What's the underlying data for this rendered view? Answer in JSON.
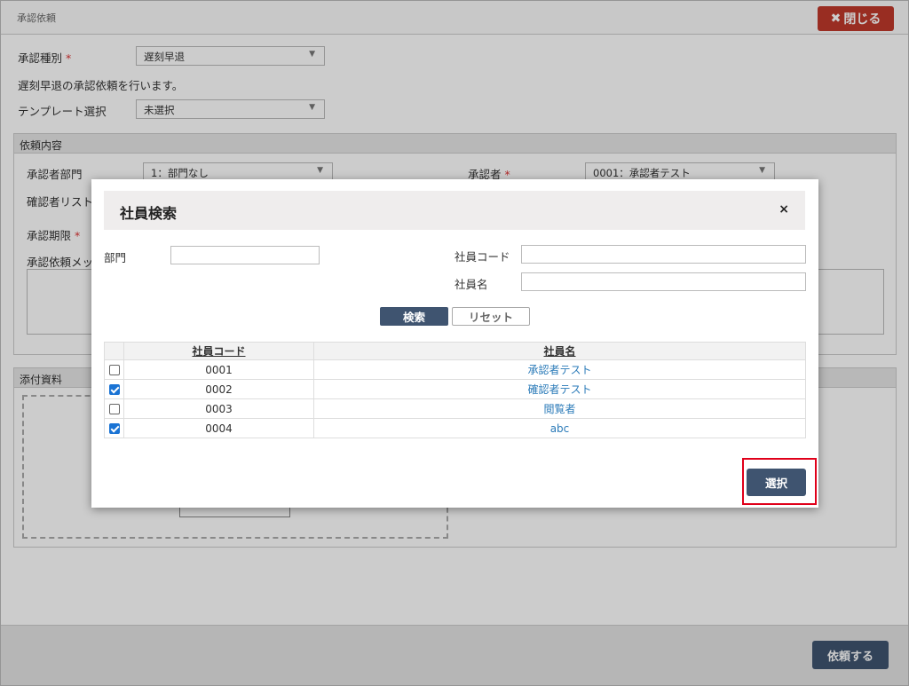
{
  "window": {
    "title": "承認依頼",
    "close_button": "閉じる",
    "close_icon": "✖"
  },
  "form": {
    "approval_type_label": "承認種別",
    "required_mark": "*",
    "approval_type_value": "遅刻早退",
    "description": "遅刻早退の承認依頼を行います。",
    "template_label": "テンプレート選択",
    "template_value": "未選択"
  },
  "request_section": {
    "heading": "依頼内容",
    "approver_dept_label": "承認者部門",
    "approver_dept_value": "1：部門なし",
    "approver_label": "承認者",
    "approver_value": "0001：承認者テスト",
    "confirmer_list_label": "確認者リスト",
    "deadline_label": "承認期限",
    "message_label": "承認依頼メッ"
  },
  "attachment_section": {
    "heading": "添付資料"
  },
  "footer": {
    "request_button": "依頼する"
  },
  "modal": {
    "title": "社員検索",
    "close_icon": "×",
    "dept_label": "部門",
    "code_label": "社員コード",
    "name_label": "社員名",
    "search_button": "検索",
    "reset_button": "リセット",
    "columns": [
      "社員コード",
      "社員名"
    ],
    "rows": [
      {
        "code": "0001",
        "name": "承認者テスト",
        "checked": false
      },
      {
        "code": "0002",
        "name": "確認者テスト",
        "checked": true
      },
      {
        "code": "0003",
        "name": "閲覧者",
        "checked": false
      },
      {
        "code": "0004",
        "name": "abc",
        "checked": true
      }
    ],
    "select_button": "選択"
  },
  "colors": {
    "primary": "#3f5470",
    "danger": "#c0392b",
    "link": "#2a7ab8",
    "highlight": "#e0001a",
    "checkbox": "#1a73d4"
  }
}
